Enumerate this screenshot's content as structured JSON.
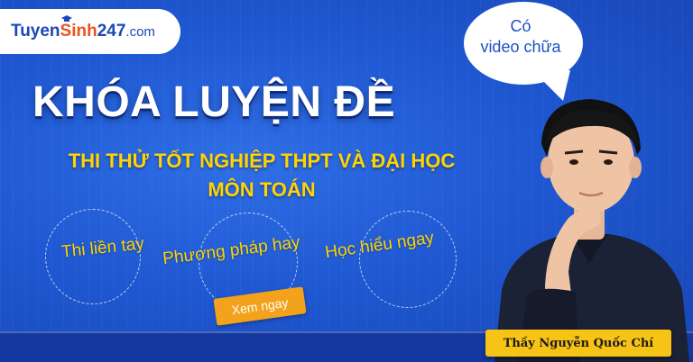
{
  "logo": {
    "part1": "Tuyen",
    "part2": "Sinh",
    "part3": "247",
    "part4": ".com"
  },
  "headline": "KHÓA LUYỆN ĐỀ",
  "subtitle": {
    "line1": "THI THỬ TỐT NGHIỆP THPT VÀ ĐẠI HỌC",
    "line2": "MÔN TOÁN"
  },
  "features": [
    "Thi liền tay",
    "Phương pháp hay",
    "Học hiểu ngay"
  ],
  "cta": "Xem ngay",
  "bubble": {
    "line1": "Có",
    "line2": "video chữa"
  },
  "teacher_name": "Thầy Nguyễn Quốc Chí",
  "colors": {
    "background": "#1f58d2",
    "accent_yellow": "#ffd400",
    "cta_orange": "#f3a21b",
    "logo_orange": "#e8541e",
    "logo_blue": "#1b48b8"
  },
  "icons": [
    "graduation-cap-icon",
    "speech-bubble-icon"
  ]
}
